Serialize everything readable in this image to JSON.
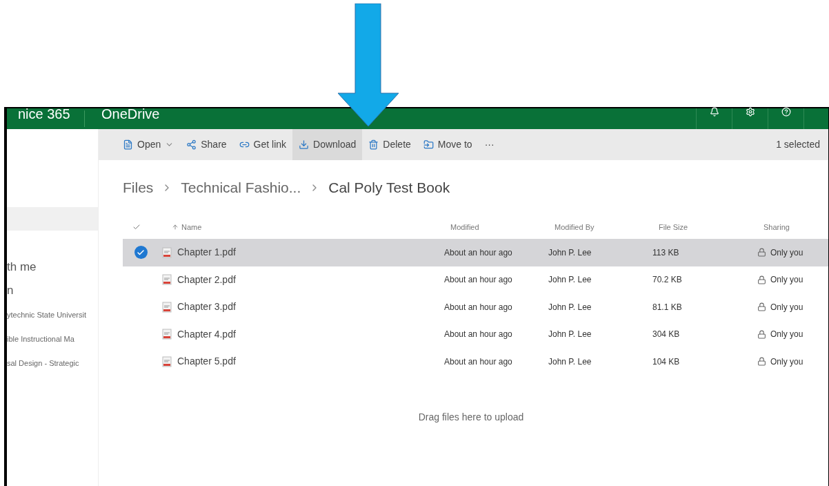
{
  "header": {
    "app_suite": "nice 365",
    "app_name": "OneDrive"
  },
  "command_bar": {
    "commands": [
      {
        "kind": "open",
        "label": "Open",
        "hovered": false
      },
      {
        "kind": "share",
        "label": "Share",
        "hovered": false
      },
      {
        "kind": "link",
        "label": "Get link",
        "hovered": false
      },
      {
        "kind": "download",
        "label": "Download",
        "hovered": true
      },
      {
        "kind": "delete",
        "label": "Delete",
        "hovered": false
      },
      {
        "kind": "move",
        "label": "Move to",
        "hovered": false
      },
      {
        "kind": "more",
        "label": "···",
        "hovered": false
      }
    ],
    "selection_count": "1 selected"
  },
  "sidebar": {
    "items": [
      {
        "label": "th me"
      },
      {
        "label": "n"
      },
      {
        "label": "ytechnic State Universit"
      },
      {
        "label": "ible Instructional Ma"
      },
      {
        "label": "sal Design - Strategic"
      }
    ]
  },
  "breadcrumb": [
    "Files",
    "Technical Fashio...",
    "Cal Poly Test Book"
  ],
  "table": {
    "columns": [
      "Name",
      "Modified",
      "Modified By",
      "File Size",
      "Sharing"
    ],
    "rows": [
      {
        "name": "Chapter 1.pdf",
        "modified": "About an hour ago",
        "modified_by": "John P. Lee",
        "size": "113 KB",
        "sharing": "Only you",
        "selected": true
      },
      {
        "name": "Chapter 2.pdf",
        "modified": "About an hour ago",
        "modified_by": "John P. Lee",
        "size": "70.2 KB",
        "sharing": "Only you",
        "selected": false
      },
      {
        "name": "Chapter 3.pdf",
        "modified": "About an hour ago",
        "modified_by": "John P. Lee",
        "size": "81.1 KB",
        "sharing": "Only you",
        "selected": false
      },
      {
        "name": "Chapter 4.pdf",
        "modified": "About an hour ago",
        "modified_by": "John P. Lee",
        "size": "304 KB",
        "sharing": "Only you",
        "selected": false
      },
      {
        "name": "Chapter 5.pdf",
        "modified": "About an hour ago",
        "modified_by": "John P. Lee",
        "size": "104 KB",
        "sharing": "Only you",
        "selected": false
      }
    ]
  },
  "drop_hint": "Drag files here to upload"
}
